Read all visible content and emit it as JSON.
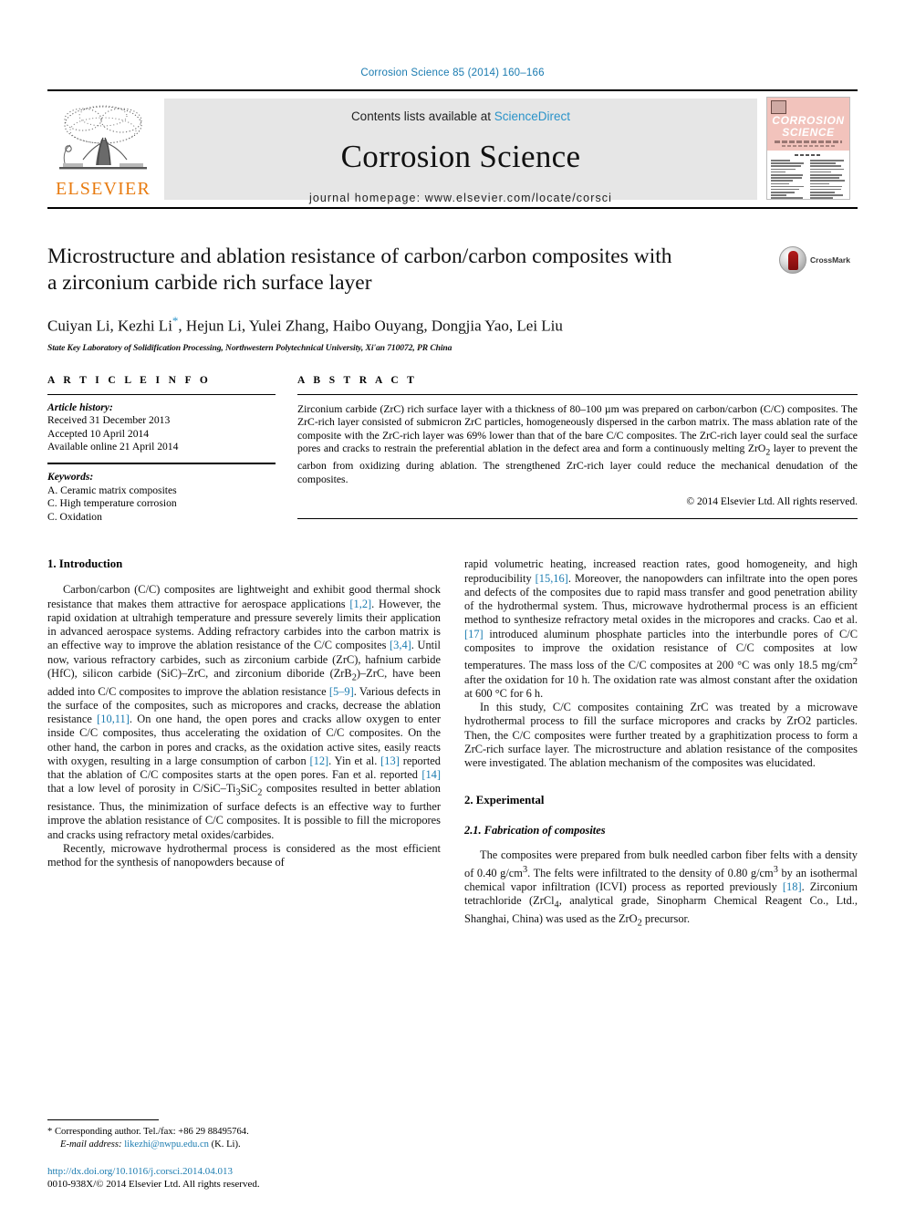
{
  "running_head": "Corrosion Science 85 (2014) 160–166",
  "masthead": {
    "publisher_name": "ELSEVIER",
    "contents_prefix": "Contents lists available at ",
    "contents_link": "ScienceDirect",
    "journal_name": "Corrosion Science",
    "homepage": "journal homepage: www.elsevier.com/locate/corsci",
    "cover_title_line1": "CORROSION",
    "cover_title_line2": "SCIENCE"
  },
  "article": {
    "title": "Microstructure and ablation resistance of carbon/carbon composites with a zirconium carbide rich surface layer",
    "crossmark_label": "CrossMark",
    "authors": "Cuiyan Li, Kezhi Li",
    "authors_rest": ", Hejun Li, Yulei Zhang, Haibo Ouyang, Dongjia Yao, Lei Liu",
    "corresponding_marker": "*",
    "affiliation": "State Key Laboratory of Solidification Processing, Northwestern Polytechnical University, Xi'an 710072, PR China"
  },
  "article_info": {
    "heading": "A R T I C L E   I N F O",
    "history_label": "Article history:",
    "received": "Received 31 December 2013",
    "accepted": "Accepted 10 April 2014",
    "available": "Available online 21 April 2014",
    "keywords_label": "Keywords:",
    "keywords": [
      "A. Ceramic matrix composites",
      "C. High temperature corrosion",
      "C. Oxidation"
    ]
  },
  "abstract": {
    "heading": "A B S T R A C T",
    "text": "Zirconium carbide (ZrC) rich surface layer with a thickness of 80–100 µm was prepared on carbon/carbon (C/C) composites. The ZrC-rich layer consisted of submicron ZrC particles, homogeneously dispersed in the carbon matrix. The mass ablation rate of the composite with the ZrC-rich layer was 69% lower than that of the bare C/C composites. The ZrC-rich layer could seal the surface pores and cracks to restrain the preferential ablation in the defect area and form a continuously melting ZrO2 layer to prevent the carbon from oxidizing during ablation. The strengthened ZrC-rich layer could reduce the mechanical denudation of the composites.",
    "copyright": "© 2014 Elsevier Ltd. All rights reserved."
  },
  "sections": {
    "introduction_heading": "1. Introduction",
    "experimental_heading": "2. Experimental",
    "fabrication_heading": "2.1. Fabrication of composites"
  },
  "body": {
    "intro_p1_a": "Carbon/carbon (C/C) composites are lightweight and exhibit good thermal shock resistance that makes them attractive for aerospace applications ",
    "intro_p1_r1": "[1,2]",
    "intro_p1_b": ". However, the rapid oxidation at ultrahigh temperature and pressure severely limits their application in advanced aerospace systems. Adding refractory carbides into the carbon matrix is an effective way to improve the ablation resistance of the C/C composites ",
    "intro_p1_r2": "[3,4]",
    "intro_p1_c": ". Until now, various refractory carbides, such as zirconium carbide (ZrC), hafnium carbide (HfC), silicon carbide (SiC)–ZrC, and zirconium diboride (ZrB2)–ZrC, have been added into C/C composites to improve the ablation resistance ",
    "intro_p1_r3": "[5–9]",
    "intro_p1_d": ". Various defects in the surface of the composites, such as micropores and cracks, decrease the ablation resistance ",
    "intro_p1_r4": "[10,11]",
    "intro_p1_e": ". On one hand, the open pores and cracks allow oxygen to enter inside C/C composites, thus accelerating the oxidation of C/C composites. On the other hand, the carbon in pores and cracks, as the oxidation active sites, easily reacts with oxygen, resulting in a large consumption of carbon ",
    "intro_p1_r5": "[12]",
    "intro_p1_f": ". Yin et al. ",
    "intro_p1_r6": "[13]",
    "intro_p1_g": " reported that the ablation of C/C composites starts at the open pores. Fan et al. reported ",
    "intro_p1_r7": "[14]",
    "intro_p1_h": " that a low level of porosity in C/SiC–Ti3SiC2 composites resulted in better ablation resistance. Thus, the minimization of surface defects is an effective way to further improve the ablation resistance of C/C composites. It is possible to fill the micropores and cracks using refractory metal oxides/carbides.",
    "intro_p2": "Recently, microwave hydrothermal process is considered as the most efficient method for the synthesis of nanopowders because of",
    "right_p1_a": "rapid volumetric heating, increased reaction rates, good homogeneity, and high reproducibility ",
    "right_p1_r1": "[15,16]",
    "right_p1_b": ". Moreover, the nanopowders can infiltrate into the open pores and defects of the composites due to rapid mass transfer and good penetration ability of the hydrothermal system. Thus, microwave hydrothermal process is an efficient method to synthesize refractory metal oxides in the micropores and cracks. Cao et al. ",
    "right_p1_r2": "[17]",
    "right_p1_c": " introduced aluminum phosphate particles into the interbundle pores of C/C composites to improve the oxidation resistance of C/C composites at low temperatures. The mass loss of the C/C composites at 200 °C was only 18.5 mg/cm2 after the oxidation for 10 h. The oxidation rate was almost constant after the oxidation at 600 °C for 6 h.",
    "right_p2": "In this study, C/C composites containing ZrC was treated by a microwave hydrothermal process to fill the surface micropores and cracks by ZrO2 particles. Then, the C/C composites were further treated by a graphitization process to form a ZrC-rich surface layer. The microstructure and ablation resistance of the composites were investigated. The ablation mechanism of the composites was elucidated.",
    "fab_p1_a": "The composites were prepared from bulk needled carbon fiber felts with a density of 0.40 g/cm3. The felts were infiltrated to the density of 0.80 g/cm3 by an isothermal chemical vapor infiltration (ICVI) process as reported previously ",
    "fab_p1_r1": "[18]",
    "fab_p1_b": ". Zirconium tetrachloride (ZrCl4, analytical grade, Sinopharm Chemical Reagent Co., Ltd., Shanghai, China) was used as the ZrO2 precursor."
  },
  "footnote": {
    "marker": "*",
    "corresponding": "Corresponding author. Tel./fax: +86 29 88495764.",
    "email_label": "E-mail address:",
    "email": "likezhi@nwpu.edu.cn",
    "email_suffix": "(K. Li).",
    "doi": "http://dx.doi.org/10.1016/j.corsci.2014.04.013",
    "issn_line": "0010-938X/© 2014 Elsevier Ltd. All rights reserved."
  },
  "colors": {
    "link": "#1a7bb0",
    "elsevier_orange": "#e87b10",
    "masthead_bg": "#e6e6e6",
    "cover_pink": "#f2c3bc"
  }
}
